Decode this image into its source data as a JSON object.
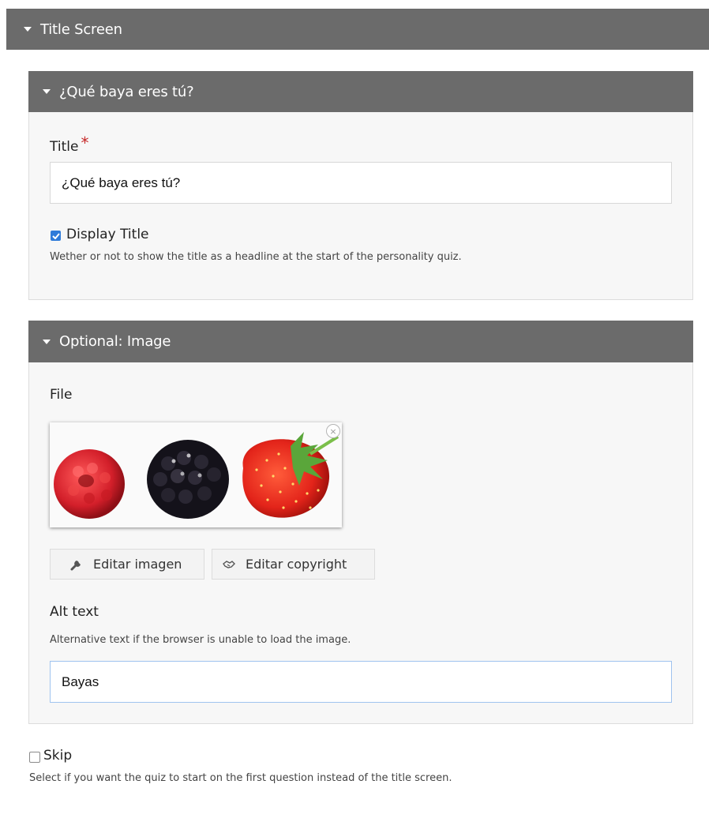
{
  "title_screen": {
    "header": "Title Screen"
  },
  "quiz_panel": {
    "header": "¿Qué baya eres tú?",
    "title_label": "Title",
    "required_mark": "*",
    "title_value": "¿Qué baya eres tú?",
    "display_title_label": "Display Title",
    "display_title_checked": true,
    "display_title_description": "Wether or not to show the title as a headline at the start of the personality quiz."
  },
  "image_panel": {
    "header": "Optional: Image",
    "file_label": "File",
    "remove_icon": "×",
    "edit_image_button": "Editar imagen",
    "edit_copyright_button": "Editar copyright",
    "alt_text_label": "Alt text",
    "alt_text_description": "Alternative text if the browser is unable to load the image.",
    "alt_text_value": "Bayas"
  },
  "skip": {
    "label": "Skip",
    "checked": false,
    "description": "Select if you want the quiz to start on the first question instead of the title screen."
  },
  "colors": {
    "header_bg": "#6b6b6b",
    "checkbox_checked": "#2f7bd9",
    "required": "#c62828"
  },
  "icons": [
    "caret-down-icon",
    "wrench-icon",
    "handshake-icon",
    "remove-icon",
    "checkmark-icon"
  ]
}
